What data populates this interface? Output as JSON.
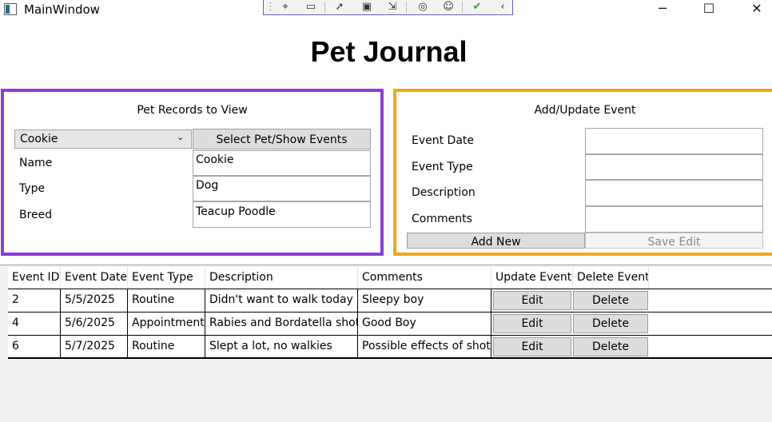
{
  "window": {
    "title": "MainWindow",
    "controls": {
      "minimize": "─",
      "maximize": "☐",
      "close": "✕"
    }
  },
  "page_title": "Pet Journal",
  "pet_panel": {
    "heading": "Pet Records to View",
    "selected_pet": "Cookie",
    "select_button": "Select Pet/Show Events",
    "fields": [
      {
        "label": "Name",
        "value": "Cookie"
      },
      {
        "label": "Type",
        "value": "Dog"
      },
      {
        "label": "Breed",
        "value": "Teacup Poodle"
      }
    ],
    "border_color": "#8b3be0"
  },
  "event_panel": {
    "heading": "Add/Update Event",
    "fields": [
      {
        "label": "Event Date",
        "value": ""
      },
      {
        "label": "Event Type",
        "value": ""
      },
      {
        "label": "Description",
        "value": ""
      },
      {
        "label": "Comments",
        "value": ""
      }
    ],
    "add_button": "Add New",
    "save_button": "Save Edit",
    "border_color": "#f2a81a"
  },
  "events_table": {
    "columns": [
      "Event ID",
      "Event Date",
      "Event Type",
      "Description",
      "Comments",
      "Update Event",
      "Delete Event"
    ],
    "rows": [
      {
        "id": "2",
        "date": "5/5/2025",
        "type": "Routine",
        "description": "Didn't want to walk today",
        "comments": "Sleepy boy",
        "edit": "Edit",
        "delete": "Delete"
      },
      {
        "id": "4",
        "date": "5/6/2025",
        "type": "Appointment",
        "description": "Rabies and Bordatella shots",
        "comments": "Good Boy",
        "edit": "Edit",
        "delete": "Delete"
      },
      {
        "id": "6",
        "date": "5/7/2025",
        "type": "Routine",
        "description": "Slept a lot, no walkies",
        "comments": "Possible effects of shots",
        "edit": "Edit",
        "delete": "Delete"
      }
    ]
  }
}
